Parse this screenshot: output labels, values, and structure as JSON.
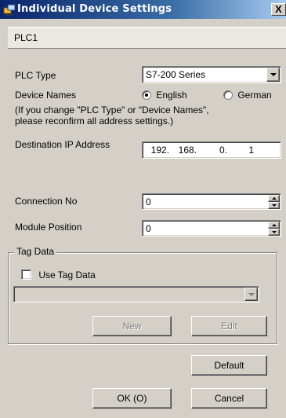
{
  "window": {
    "title": "Individual Device Settings",
    "close_glyph": "X"
  },
  "plc_name": "PLC1",
  "plc_type": {
    "label": "PLC Type",
    "value": "S7-200 Series"
  },
  "device_names": {
    "label": "Device Names",
    "options": [
      "English",
      "German"
    ],
    "selected": "English"
  },
  "note": {
    "line1": "(If you change \"PLC Type\" or \"Device Names\",",
    "line2": "please reconfirm all address settings.)"
  },
  "destination_ip": {
    "label": "Destination IP Address",
    "octets": [
      "192.",
      "168.",
      "0.",
      "1"
    ]
  },
  "connection_no": {
    "label": "Connection No",
    "value": "0"
  },
  "module_position": {
    "label": "Module Position",
    "value": "0"
  },
  "tag_data": {
    "group_label": "Tag Data",
    "use_label": "Use Tag Data",
    "checked": false,
    "select_value": "",
    "new_label": "New",
    "edit_label": "Edit"
  },
  "buttons": {
    "default": "Default",
    "ok": "OK (O)",
    "cancel": "Cancel"
  },
  "icons": {
    "app": "network-device-icon",
    "close": "close-icon",
    "dropdown": "chevron-down-icon",
    "spin": "spinner-arrows-icon"
  },
  "colors": {
    "title_start": "#0a246a",
    "title_end": "#a6caf0",
    "face": "#d4d0c8"
  }
}
